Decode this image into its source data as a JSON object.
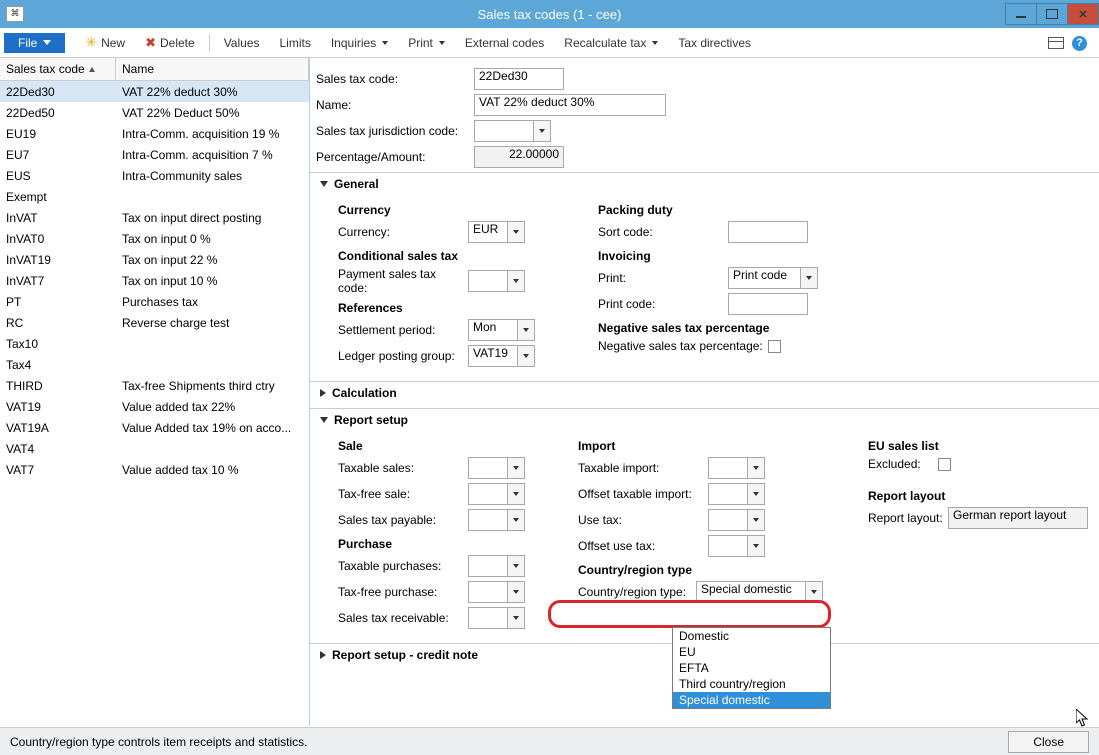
{
  "window": {
    "title": "Sales tax codes (1 - cee)"
  },
  "toolbar": {
    "file": "File",
    "new": "New",
    "delete": "Delete",
    "values": "Values",
    "limits": "Limits",
    "inquiries": "Inquiries",
    "print": "Print",
    "external_codes": "External codes",
    "recalculate": "Recalculate tax",
    "tax_directives": "Tax directives"
  },
  "grid": {
    "col1": "Sales tax code",
    "col2": "Name",
    "rows": [
      {
        "code": "22Ded30",
        "name": "VAT 22% deduct 30%"
      },
      {
        "code": "22Ded50",
        "name": "VAT 22% Deduct 50%"
      },
      {
        "code": "EU19",
        "name": "Intra-Comm. acquisition 19 %"
      },
      {
        "code": "EU7",
        "name": "Intra-Comm. acquisition 7 %"
      },
      {
        "code": "EUS",
        "name": "Intra-Community sales"
      },
      {
        "code": "Exempt",
        "name": ""
      },
      {
        "code": "InVAT",
        "name": "Tax on input direct posting"
      },
      {
        "code": "InVAT0",
        "name": "Tax on input 0 %"
      },
      {
        "code": "InVAT19",
        "name": "Tax on input 22 %"
      },
      {
        "code": "InVAT7",
        "name": "Tax on input 10 %"
      },
      {
        "code": "PT",
        "name": "Purchases tax"
      },
      {
        "code": "RC",
        "name": "Reverse charge test"
      },
      {
        "code": "Tax10",
        "name": ""
      },
      {
        "code": "Tax4",
        "name": ""
      },
      {
        "code": "THIRD",
        "name": "Tax-free Shipments third ctry"
      },
      {
        "code": "VAT19",
        "name": "Value added tax 22%"
      },
      {
        "code": "VAT19A",
        "name": "Value Added tax 19% on acco..."
      },
      {
        "code": "VAT4",
        "name": ""
      },
      {
        "code": "VAT7",
        "name": "Value added tax 10 %"
      }
    ]
  },
  "detail": {
    "labels": {
      "code": "Sales tax code:",
      "name": "Name:",
      "jurisdiction": "Sales tax jurisdiction code:",
      "pct": "Percentage/Amount:"
    },
    "values": {
      "code": "22Ded30",
      "name": "VAT 22% deduct 30%",
      "jurisdiction": "",
      "pct": "22.00000"
    }
  },
  "general": {
    "title": "General",
    "currency_h": "Currency",
    "currency_l": "Currency:",
    "currency_v": "EUR",
    "cond_h": "Conditional sales tax",
    "payment_l": "Payment sales tax code:",
    "ref_h": "References",
    "settlement_l": "Settlement period:",
    "settlement_v": "Mon",
    "ledger_l": "Ledger posting group:",
    "ledger_v": "VAT19",
    "packing_h": "Packing duty",
    "sort_l": "Sort code:",
    "invoicing_h": "Invoicing",
    "print_l": "Print:",
    "print_v": "Print code",
    "printcode_l": "Print code:",
    "neg_h": "Negative sales tax percentage",
    "neg_l": "Negative sales tax percentage:"
  },
  "calculation": {
    "title": "Calculation"
  },
  "report": {
    "title": "Report setup",
    "sale_h": "Sale",
    "taxable_sales": "Taxable sales:",
    "taxfree_sale": "Tax-free sale:",
    "sales_tax_payable": "Sales tax payable:",
    "purchase_h": "Purchase",
    "taxable_purchases": "Taxable purchases:",
    "taxfree_purchase": "Tax-free purchase:",
    "sales_tax_receivable": "Sales tax receivable:",
    "import_h": "Import",
    "taxable_import": "Taxable import:",
    "offset_taxable_import": "Offset taxable import:",
    "use_tax": "Use tax:",
    "offset_use_tax": "Offset use tax:",
    "crt_h": "Country/region type",
    "crt_l": "Country/region type:",
    "crt_v": "Special domestic",
    "crt_opts": [
      "Domestic",
      "EU",
      "EFTA",
      "Third country/region",
      "Special domestic"
    ],
    "eu_h": "EU sales list",
    "excluded_l": "Excluded:",
    "layout_h": "Report layout",
    "layout_l": "Report layout:",
    "layout_v": "German report layout"
  },
  "report_credit": {
    "title": "Report setup - credit note"
  },
  "status": {
    "help": "Country/region type controls item receipts and statistics.",
    "close": "Close"
  }
}
